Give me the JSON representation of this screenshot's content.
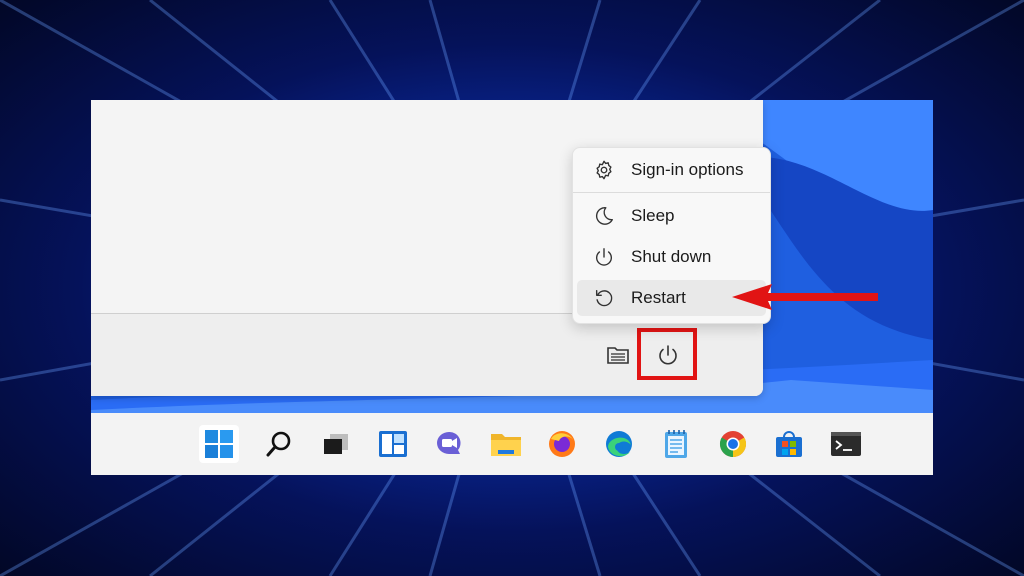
{
  "power_menu": {
    "items": [
      {
        "label": "Sign-in options",
        "icon": "gear-icon"
      },
      {
        "label": "Sleep",
        "icon": "moon-icon"
      },
      {
        "label": "Shut down",
        "icon": "power-icon"
      },
      {
        "label": "Restart",
        "icon": "restart-icon"
      }
    ],
    "hovered": "Restart"
  },
  "start_footer": {
    "icons": [
      "file-explorer-icon",
      "power-icon"
    ]
  },
  "taskbar": {
    "apps": [
      "windows-start-icon",
      "search-icon",
      "task-view-icon",
      "widgets-icon",
      "teams-chat-icon",
      "file-explorer-icon",
      "firefox-icon",
      "edge-icon",
      "notepad-icon",
      "chrome-icon",
      "store-icon",
      "terminal-icon"
    ]
  },
  "colors": {
    "highlight": "#e11414",
    "arrow": "#e11414",
    "accent": "#2b6ef0"
  }
}
